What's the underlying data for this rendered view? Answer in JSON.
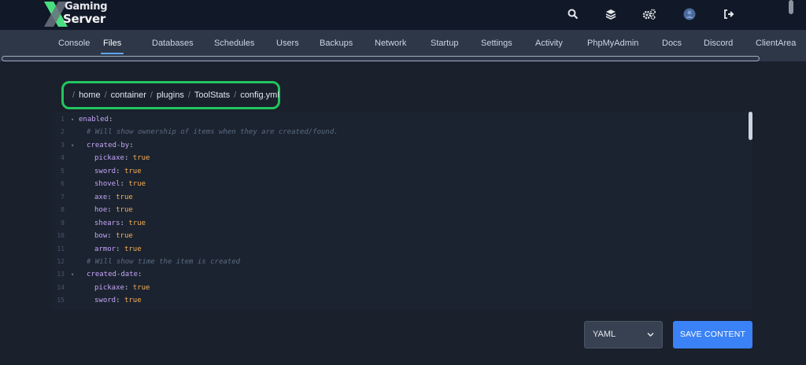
{
  "brand": {
    "line1": "Gaming",
    "line2": "Server"
  },
  "header_icons": [
    "search-icon",
    "layers-icon",
    "cogs-icon",
    "avatar",
    "sign-out-icon"
  ],
  "nav": {
    "tabs": [
      {
        "label": "Console"
      },
      {
        "label": "Files",
        "active": true
      },
      {
        "label": "Databases"
      },
      {
        "label": "Schedules"
      },
      {
        "label": "Users"
      },
      {
        "label": "Backups"
      },
      {
        "label": "Network"
      },
      {
        "label": "Startup"
      },
      {
        "label": "Settings"
      },
      {
        "label": "Activity"
      },
      {
        "label": "PhpMyAdmin"
      },
      {
        "label": "Docs"
      },
      {
        "label": "Discord"
      },
      {
        "label": "ClientArea"
      }
    ]
  },
  "breadcrumb": {
    "separator": "/",
    "parts": [
      "home",
      "container",
      "plugins",
      "ToolStats",
      "config.yml"
    ]
  },
  "editor": {
    "lines": [
      {
        "n": "1",
        "fold": true,
        "indent": 0,
        "key": "enabled"
      },
      {
        "n": "2",
        "indent": 1,
        "comment": "# Will show ownership of items when they are created/found."
      },
      {
        "n": "3",
        "fold": true,
        "indent": 1,
        "key": "created-by"
      },
      {
        "n": "4",
        "indent": 2,
        "key": "pickaxe",
        "value": "true"
      },
      {
        "n": "5",
        "indent": 2,
        "key": "sword",
        "value": "true"
      },
      {
        "n": "6",
        "indent": 2,
        "key": "shovel",
        "value": "true"
      },
      {
        "n": "7",
        "indent": 2,
        "key": "axe",
        "value": "true"
      },
      {
        "n": "8",
        "indent": 2,
        "key": "hoe",
        "value": "true"
      },
      {
        "n": "9",
        "indent": 2,
        "key": "shears",
        "value": "true"
      },
      {
        "n": "10",
        "indent": 2,
        "key": "bow",
        "value": "true"
      },
      {
        "n": "11",
        "indent": 2,
        "key": "armor",
        "value": "true"
      },
      {
        "n": "12",
        "indent": 1,
        "comment": "# Will show time the item is created"
      },
      {
        "n": "13",
        "fold": true,
        "indent": 1,
        "key": "created-date"
      },
      {
        "n": "14",
        "indent": 2,
        "key": "pickaxe",
        "value": "true"
      },
      {
        "n": "15",
        "indent": 2,
        "key": "sword",
        "value": "true"
      }
    ]
  },
  "footer": {
    "language": "YAML",
    "save_label": "SAVE CONTENT"
  },
  "colors": {
    "accent": "#3b82f6",
    "highlight": "#22c55e",
    "yaml_key": "#c4a5f5",
    "yaml_value": "#f6ad55"
  }
}
